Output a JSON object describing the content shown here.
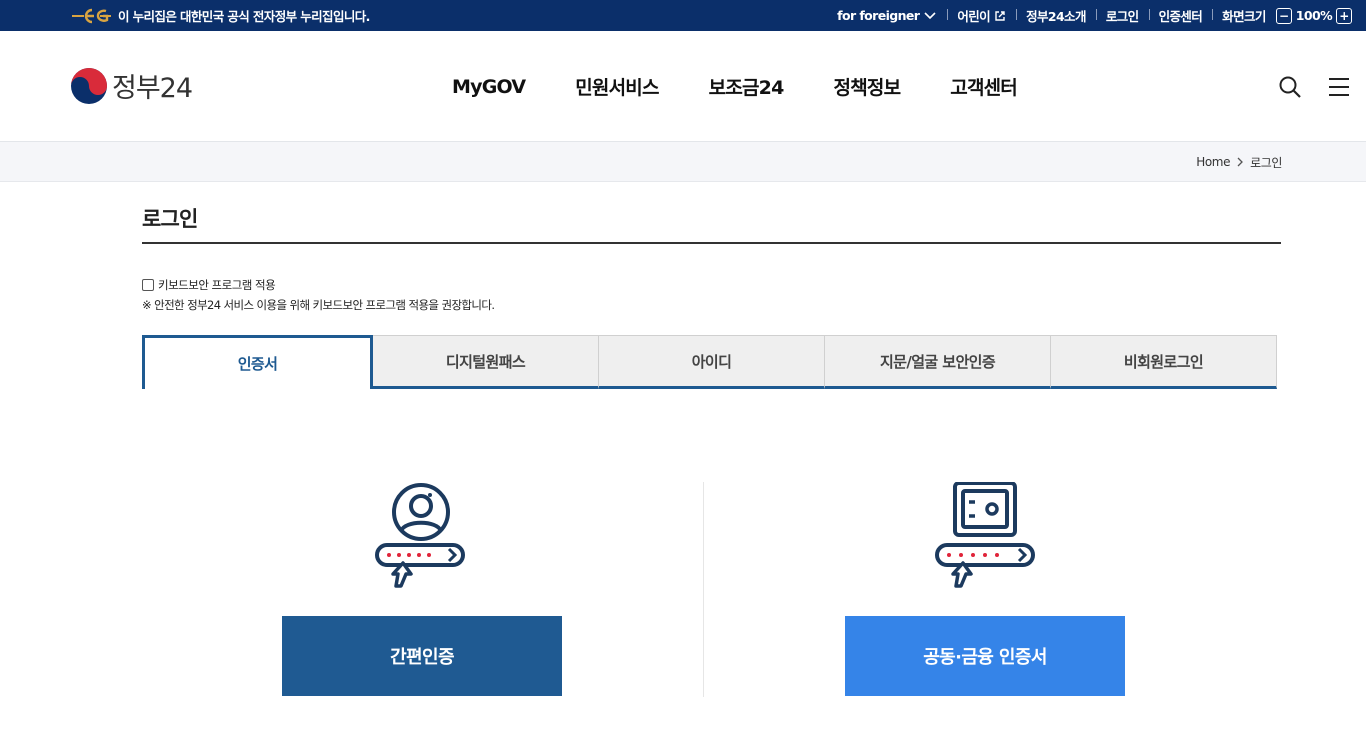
{
  "topbar": {
    "notice": "이 누리집은 대한민국 공식 전자정부 누리집입니다.",
    "util": {
      "foreigner": "for foreigner",
      "kids": "어린이",
      "about": "정부24소개",
      "login": "로그인",
      "cert_center": "인증센터",
      "zoom_label": "화면크기",
      "zoom_minus": "−",
      "zoom_value": "100%",
      "zoom_plus": "+"
    }
  },
  "header": {
    "logo_text": "정부24",
    "nav": [
      "MyGOV",
      "민원서비스",
      "보조금24",
      "정책정보",
      "고객센터"
    ],
    "icons": [
      "search-icon",
      "menu-icon"
    ]
  },
  "breadcrumb": {
    "home": "Home",
    "current": "로그인"
  },
  "page": {
    "title": "로그인",
    "keyboard_security_label": "키보드보안 프로그램 적용",
    "keyboard_security_note": "※ 안전한 정부24 서비스 이용을 위해 키보드보안 프로그램 적용을 권장합니다."
  },
  "tabs": [
    {
      "label": "인증서",
      "active": true
    },
    {
      "label": "디지털원패스",
      "active": false
    },
    {
      "label": "아이디",
      "active": false
    },
    {
      "label": "지문/얼굴 보안인증",
      "active": false
    },
    {
      "label": "비회원로그인",
      "active": false
    }
  ],
  "login_options": {
    "simple_auth_label": "간편인증",
    "joint_cert_label": "공동·금융 인증서"
  },
  "colors": {
    "topbar_bg": "#0b2f6a",
    "primary": "#1f5a92",
    "accent": "#3584e8",
    "icon_stroke": "#1c3a5e",
    "dot_red": "#e0243a"
  }
}
